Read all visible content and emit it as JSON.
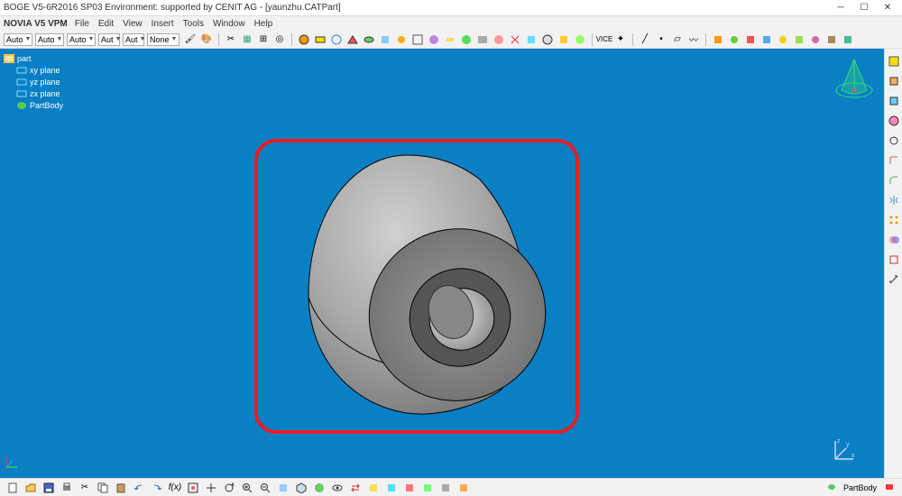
{
  "title": "BOGE V5-6R2016 SP03 Environment: supported by CENIT AG - [yaunzhu.CATPart]",
  "app_brand": "NOVIA V5 VPM",
  "menu": {
    "file": "File",
    "edit": "Edit",
    "view": "View",
    "insert": "Insert",
    "tools": "Tools",
    "window": "Window",
    "help": "Help"
  },
  "combos": {
    "c1": "Auto",
    "c2": "Auto",
    "c3": "Auto",
    "c4": "Aut",
    "c5": "Aut",
    "c6": "None"
  },
  "tree": {
    "root": "part",
    "n1": "xy plane",
    "n2": "yz plane",
    "n3": "zx plane",
    "n4": "PartBody"
  },
  "status": {
    "partbody": "PartBody"
  }
}
